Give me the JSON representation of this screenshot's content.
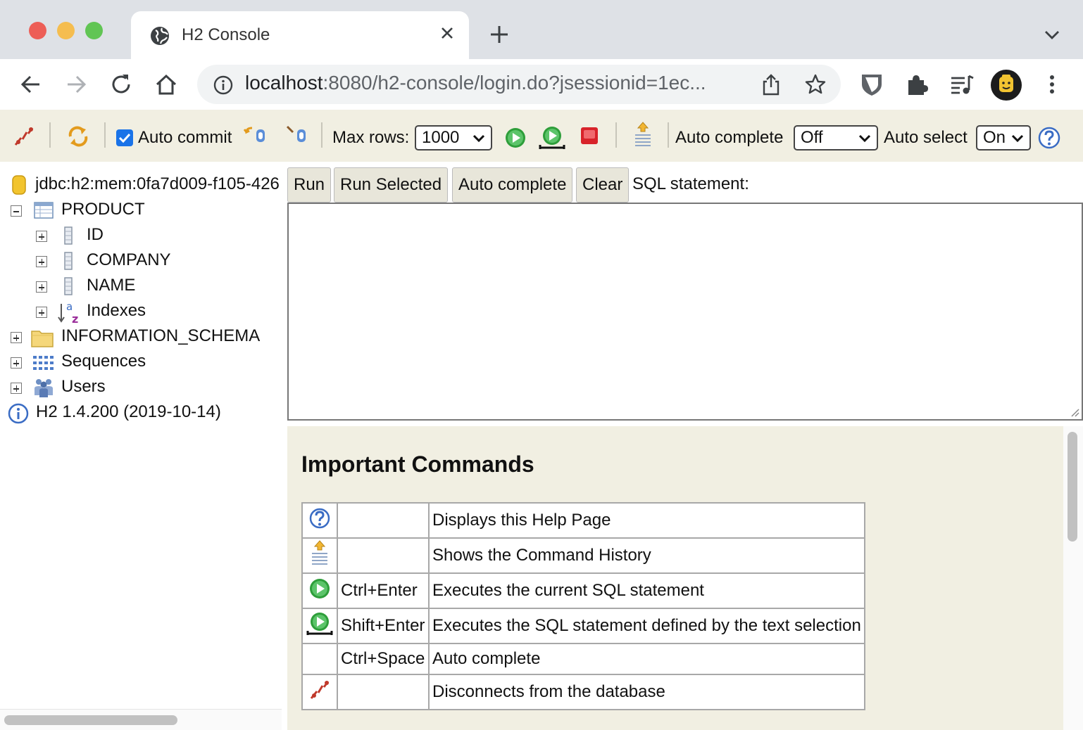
{
  "browser": {
    "tab_title": "H2 Console",
    "url_host": "localhost",
    "url_rest": ":8080/h2-console/login.do?jsessionid=1ec..."
  },
  "h2_toolbar": {
    "auto_commit_label": "Auto commit",
    "auto_commit_checked": true,
    "max_rows_label": "Max rows:",
    "max_rows_value": "1000",
    "auto_complete_label": "Auto complete",
    "auto_complete_value": "Off",
    "auto_select_label": "Auto select",
    "auto_select_value": "On"
  },
  "tree": {
    "connection": "jdbc:h2:mem:0fa7d009-f105-426",
    "table": "PRODUCT",
    "columns": [
      "ID",
      "COMPANY",
      "NAME"
    ],
    "indexes": "Indexes",
    "schema": "INFORMATION_SCHEMA",
    "sequences": "Sequences",
    "users": "Users",
    "version": "H2 1.4.200 (2019-10-14)"
  },
  "query": {
    "run": "Run",
    "run_selected": "Run Selected",
    "auto_complete": "Auto complete",
    "clear": "Clear",
    "sql_label": "SQL statement:",
    "sql_text": ""
  },
  "help": {
    "title": "Important Commands",
    "rows": [
      {
        "icon": "help-icon",
        "key": "",
        "desc": "Displays this Help Page"
      },
      {
        "icon": "history-icon",
        "key": "",
        "desc": "Shows the Command History"
      },
      {
        "icon": "run-icon",
        "key": "Ctrl+Enter",
        "desc": "Executes the current SQL statement"
      },
      {
        "icon": "run-selected-icon",
        "key": "Shift+Enter",
        "desc": "Executes the SQL statement defined by the text selection"
      },
      {
        "icon": "",
        "key": "Ctrl+Space",
        "desc": "Auto complete"
      },
      {
        "icon": "disconnect-icon",
        "key": "",
        "desc": "Disconnects from the database"
      }
    ]
  },
  "colors": {
    "accent": "#1a73e8",
    "panel": "#f1efe2",
    "run_green": "#2e9e3a",
    "stop_red": "#d8232a"
  }
}
